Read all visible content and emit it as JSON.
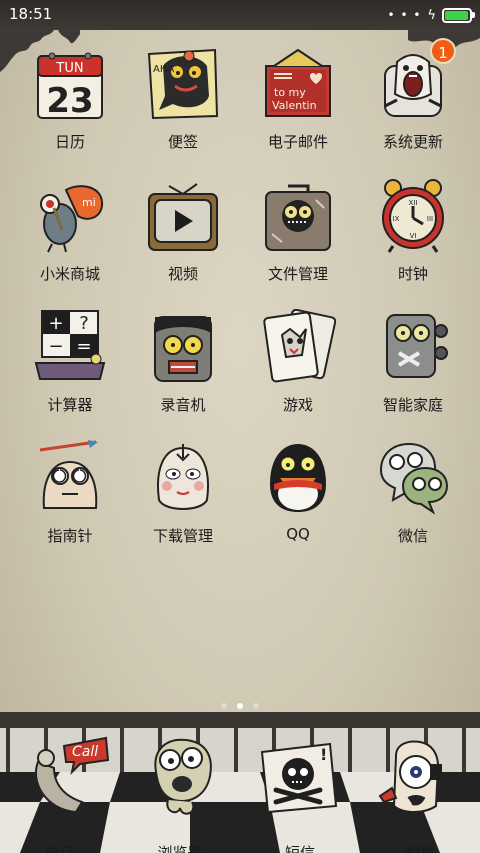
{
  "status_bar": {
    "time": "18:51",
    "battery_level": 0.95,
    "badge_count": "1"
  },
  "grid": [
    {
      "label": "日历",
      "icon": "calendar-icon",
      "icon_text": [
        "TUN",
        "23"
      ]
    },
    {
      "label": "便签",
      "icon": "notes-icon",
      "icon_text": [
        "AHA"
      ]
    },
    {
      "label": "电子邮件",
      "icon": "email-icon",
      "icon_text": [
        "to my",
        "Valentin"
      ]
    },
    {
      "label": "系统更新",
      "icon": "system-update-icon"
    },
    {
      "label": "小米商城",
      "icon": "mi-store-icon",
      "icon_text": [
        "mi"
      ]
    },
    {
      "label": "视频",
      "icon": "video-icon"
    },
    {
      "label": "文件管理",
      "icon": "file-manager-icon"
    },
    {
      "label": "时钟",
      "icon": "clock-icon",
      "icon_text": [
        "XII",
        "III",
        "VI",
        "IX"
      ]
    },
    {
      "label": "计算器",
      "icon": "calculator-icon",
      "icon_text": [
        "+",
        "?",
        "−",
        "="
      ]
    },
    {
      "label": "录音机",
      "icon": "recorder-icon"
    },
    {
      "label": "游戏",
      "icon": "games-icon"
    },
    {
      "label": "智能家庭",
      "icon": "smart-home-icon"
    },
    {
      "label": "指南针",
      "icon": "compass-icon"
    },
    {
      "label": "下载管理",
      "icon": "download-manager-icon"
    },
    {
      "label": "QQ",
      "icon": "qq-icon"
    },
    {
      "label": "微信",
      "icon": "wechat-icon"
    }
  ],
  "page_indicator": {
    "pages": 3,
    "current": 2
  },
  "dock": [
    {
      "label": "电话",
      "icon": "phone-icon",
      "icon_text": [
        "Call"
      ]
    },
    {
      "label": "浏览器",
      "icon": "browser-icon"
    },
    {
      "label": "短信",
      "icon": "messages-icon",
      "icon_text": [
        "!"
      ]
    },
    {
      "label": "相机",
      "icon": "camera-icon"
    }
  ]
}
